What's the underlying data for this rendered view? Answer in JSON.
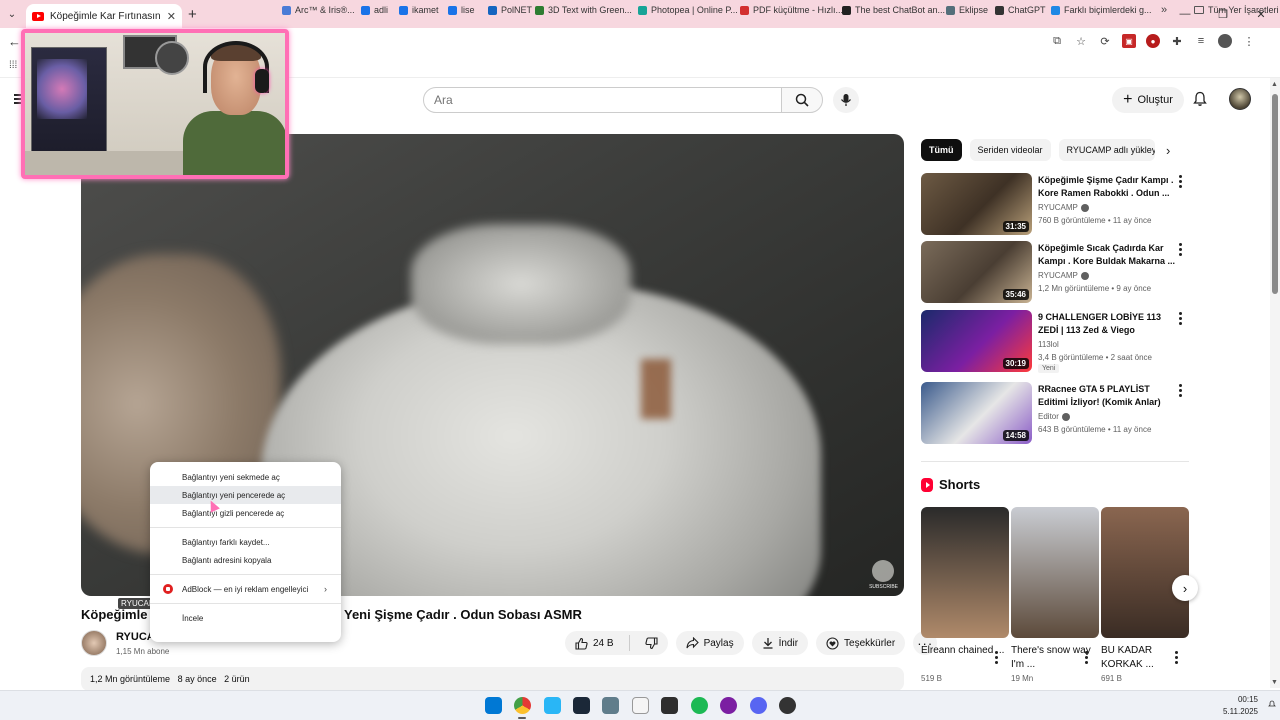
{
  "browser": {
    "tab_title": "Köpeğimle Kar Fırtınasında Kam",
    "tab_close": "✕",
    "new_tab": "+",
    "window_controls": [
      "—",
      "❐",
      "✕"
    ],
    "bookmarks": [
      {
        "label": "Arc™ & Iris®...",
        "color": "#4a7bd6"
      },
      {
        "label": "adli",
        "color": "#1a73e8"
      },
      {
        "label": "ikamet",
        "color": "#1a73e8"
      },
      {
        "label": "lise",
        "color": "#1a73e8"
      },
      {
        "label": "PolNET",
        "color": "#1565c0"
      },
      {
        "label": "3D Text with Green...",
        "color": "#2e7d32"
      },
      {
        "label": "Photopea | Online P...",
        "color": "#18a497"
      },
      {
        "label": "PDF küçültme - Hızlı...",
        "color": "#d32f2f"
      },
      {
        "label": "The best ChatBot an...",
        "color": "#212121"
      },
      {
        "label": "Eklipse",
        "color": "#546e7a"
      },
      {
        "label": "ChatGPT",
        "color": "#333333"
      },
      {
        "label": "Farklı biçimlerdeki g...",
        "color": "#1e88e5"
      }
    ],
    "bookmarks_more": "»",
    "all_bookmarks": "Tüm Yer İşaretleri"
  },
  "youtube": {
    "search_placeholder": "Ara",
    "create_label": "Oluştur",
    "video": {
      "title_left": "Köpeğimle",
      "title_right": "Yeni Şişme Çadır . Odun Sobası ASMR",
      "channel_tag": "RYUCAMP",
      "channel_name": "RYUCA",
      "subscribers": "1,15 Mn abone",
      "likes": "24 B",
      "share": "Paylaş",
      "download": "İndir",
      "thanks": "Teşekkürler",
      "watermark": "SUBSCRIBE"
    },
    "description": {
      "views": "1,2 Mn görüntüleme",
      "age": "8 ay önce",
      "products": "2 ürün"
    },
    "chips": [
      "Tümü",
      "Seriden videolar",
      "RYUCAMP adlı yükleyen"
    ],
    "recommendations": [
      {
        "title": "Köpeğimle Şişme Çadır Kampı . Kore Ramen Rabokki . Odun ...",
        "channel": "RYUCAMP",
        "verified": true,
        "meta": "760 B görüntüleme • 11 ay önce",
        "duration": "31:35",
        "colors": [
          "#6d5a44",
          "#3e3125",
          "#b9a07a"
        ]
      },
      {
        "title": "Köpeğimle Sıcak Çadırda Kar Kampı . Kore Buldak Makarna ...",
        "channel": "RYUCAMP",
        "verified": true,
        "meta": "1,2 Mn görüntüleme • 9 ay önce",
        "duration": "35:46",
        "colors": [
          "#7a6b5a",
          "#4a3e33",
          "#c9b393"
        ]
      },
      {
        "title": "9 CHALLENGER LOBİYE 113 ZEDİ | 113 Zed & Viego",
        "channel": "113lol",
        "verified": false,
        "meta": "3,4 B görüntüleme • 2 saat önce",
        "duration": "30:19",
        "badge": "Yeni",
        "colors": [
          "#1b2a6b",
          "#7b1fa2",
          "#ff3a3a"
        ]
      },
      {
        "title": "RRacnee GTA 5 PLAYLİST Editimi İzliyor! (Komik Anlar)",
        "channel": "Editor",
        "verified": true,
        "meta": "643 B görüntüleme • 11 ay önce",
        "duration": "14:58",
        "colors": [
          "#3a5a8c",
          "#e6e6e6",
          "#8a5cc7"
        ]
      }
    ],
    "shorts_title": "Shorts",
    "shorts": [
      {
        "title": "Elreann chained ...",
        "views": "519 B",
        "colors": [
          "#2a2a2a",
          "#b08a6a"
        ]
      },
      {
        "title": "There's snow way I'm ...",
        "views": "19 Mn",
        "colors": [
          "#c9ccd2",
          "#5c4a3a"
        ]
      },
      {
        "title": "BU KADAR KORKAK ...",
        "views": "691 B",
        "colors": [
          "#8a6650",
          "#3a2c24"
        ]
      }
    ]
  },
  "context_menu": {
    "items": [
      "Bağlantıyı yeni sekmede aç",
      "Bağlantıyı yeni pencerede aç",
      "Bağlantıyı gizli pencerede aç",
      "Bağlantıyı farklı kaydet...",
      "Bağlantı adresini kopyala",
      "AdBlock — en iyi reklam engelleyici",
      "İncele"
    ]
  },
  "taskbar": {
    "time": "00:15",
    "date": "5.11.2025",
    "apps": [
      {
        "name": "windows-start",
        "color": "#0078d4"
      },
      {
        "name": "chrome",
        "color": "#e53935"
      },
      {
        "name": "snipping",
        "color": "#29b6f6"
      },
      {
        "name": "steam",
        "color": "#1b2838"
      },
      {
        "name": "calculator",
        "color": "#607d8b"
      },
      {
        "name": "app-six",
        "color": "#f5f5f5"
      },
      {
        "name": "notes",
        "color": "#2e2e2e"
      },
      {
        "name": "spotify",
        "color": "#1db954"
      },
      {
        "name": "app-nine",
        "color": "#7b1fa2"
      },
      {
        "name": "discord",
        "color": "#5865f2"
      },
      {
        "name": "app-eleven",
        "color": "#333333"
      }
    ]
  }
}
